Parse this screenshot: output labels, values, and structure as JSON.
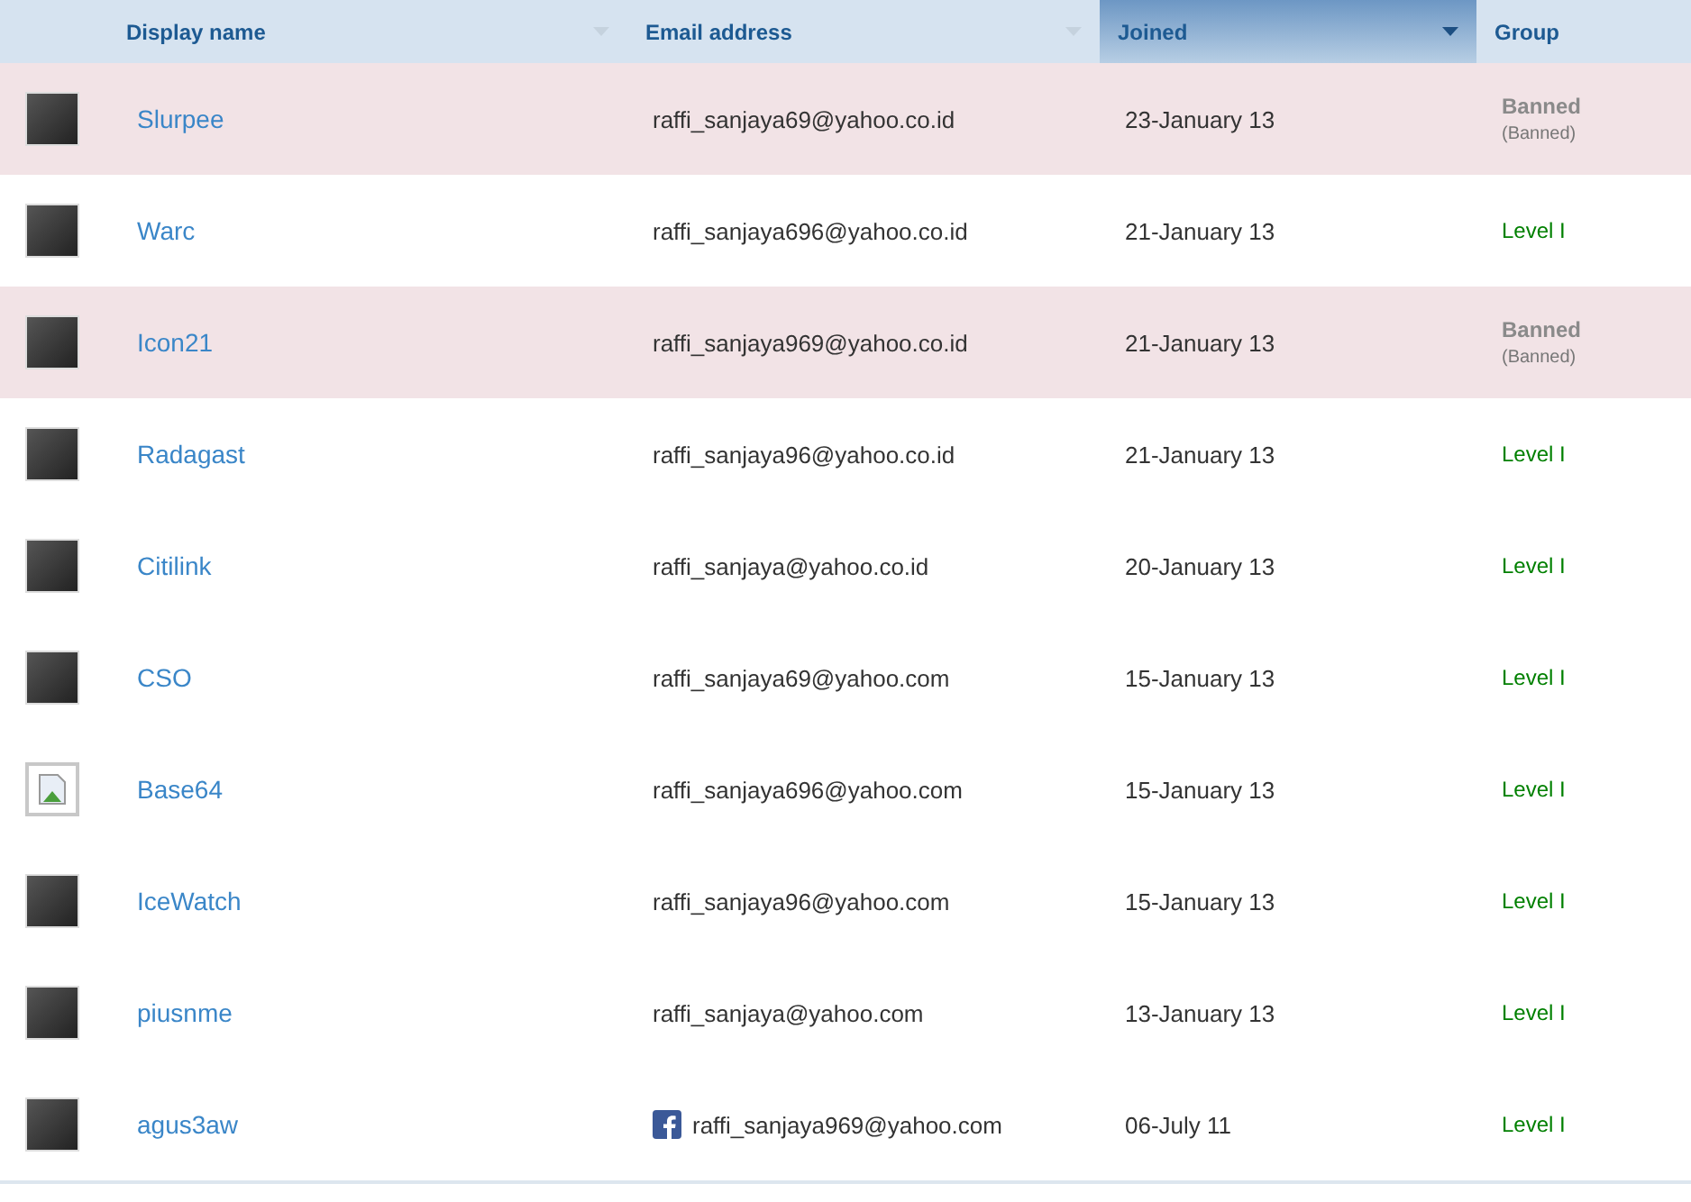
{
  "columns": [
    {
      "label": "Display name",
      "sortable": true,
      "sorted": false
    },
    {
      "label": "Email address",
      "sortable": true,
      "sorted": false
    },
    {
      "label": "Joined",
      "sortable": true,
      "sorted": true
    },
    {
      "label": "Group",
      "sortable": false,
      "sorted": false
    }
  ],
  "rows": [
    {
      "broken_image": false,
      "name": "Slurpee",
      "email": "raffi_sanjaya69@yahoo.co.id",
      "facebook": false,
      "joined": "23-January 13",
      "banned": true,
      "group": "Banned",
      "group_note": "(Banned)"
    },
    {
      "broken_image": false,
      "name": "Warc",
      "email": "raffi_sanjaya696@yahoo.co.id",
      "facebook": false,
      "joined": "21-January 13",
      "banned": false,
      "group": "Level I"
    },
    {
      "broken_image": false,
      "name": "Icon21",
      "email": "raffi_sanjaya969@yahoo.co.id",
      "facebook": false,
      "joined": "21-January 13",
      "banned": true,
      "group": "Banned",
      "group_note": "(Banned)"
    },
    {
      "broken_image": false,
      "name": "Radagast",
      "email": "raffi_sanjaya96@yahoo.co.id",
      "facebook": false,
      "joined": "21-January 13",
      "banned": false,
      "group": "Level I"
    },
    {
      "broken_image": false,
      "name": "Citilink",
      "email": "raffi_sanjaya@yahoo.co.id",
      "facebook": false,
      "joined": "20-January 13",
      "banned": false,
      "group": "Level I"
    },
    {
      "broken_image": false,
      "name": "CSO",
      "email": "raffi_sanjaya69@yahoo.com",
      "facebook": false,
      "joined": "15-January 13",
      "banned": false,
      "group": "Level I"
    },
    {
      "broken_image": true,
      "name": "Base64",
      "email": "raffi_sanjaya696@yahoo.com",
      "facebook": false,
      "joined": "15-January 13",
      "banned": false,
      "group": "Level I"
    },
    {
      "broken_image": false,
      "name": "IceWatch",
      "email": "raffi_sanjaya96@yahoo.com",
      "facebook": false,
      "joined": "15-January 13",
      "banned": false,
      "group": "Level I"
    },
    {
      "broken_image": false,
      "name": "piusnme",
      "email": "raffi_sanjaya@yahoo.com",
      "facebook": false,
      "joined": "13-January 13",
      "banned": false,
      "group": "Level I"
    },
    {
      "broken_image": false,
      "name": "agus3aw",
      "email": "raffi_sanjaya969@yahoo.com",
      "facebook": true,
      "joined": "06-July 11",
      "banned": false,
      "group": "Level I"
    }
  ]
}
